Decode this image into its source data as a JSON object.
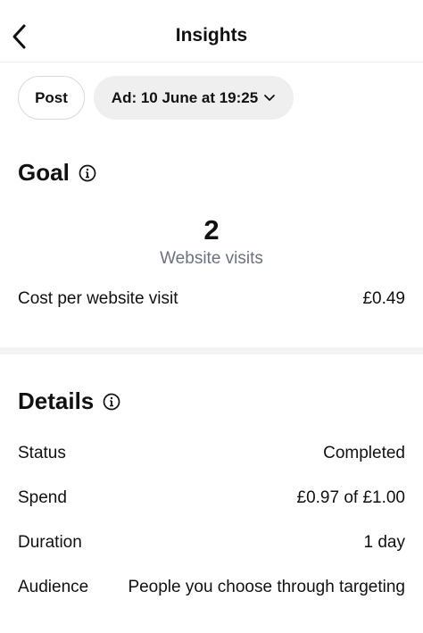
{
  "header": {
    "title": "Insights"
  },
  "filters": {
    "post_label": "Post",
    "ad_label": "Ad: 10 June at 19:25"
  },
  "goal": {
    "title": "Goal",
    "metric_value": "2",
    "metric_label": "Website visits",
    "cost_label": "Cost per website visit",
    "cost_value": "£0.49"
  },
  "details": {
    "title": "Details",
    "rows": [
      {
        "label": "Status",
        "value": "Completed"
      },
      {
        "label": "Spend",
        "value": "£0.97 of £1.00"
      },
      {
        "label": "Duration",
        "value": "1 day"
      },
      {
        "label": "Audience",
        "value": "People you choose through targeting"
      }
    ]
  },
  "icons": {
    "back": "chevron-left-icon",
    "dropdown": "chevron-down-icon",
    "info": "info-icon"
  }
}
